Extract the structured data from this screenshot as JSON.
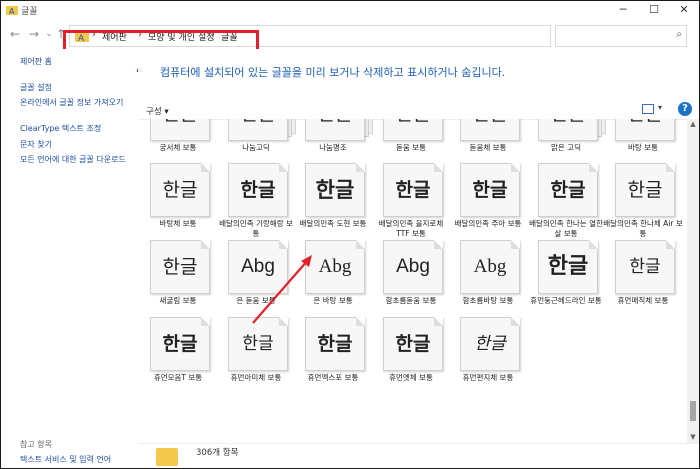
{
  "window": {
    "title": "글꼴",
    "controls": {
      "minimize": "─",
      "maximize": "☐",
      "close": "✕"
    }
  },
  "nav": {
    "back": "←",
    "forward": "→",
    "recent": "⌄",
    "up": "↑",
    "breadcrumbs": [
      "제어판",
      "모양 및 개인 설정",
      "글꼴"
    ],
    "separator": "›",
    "refresh": "↻",
    "search_placeholder": ""
  },
  "sidebar": {
    "links": [
      "제어판 홈",
      "글꼴 설정",
      "온라인에서 글꼴 정보 가져오기",
      "ClearType 텍스트 조정",
      "문자 찾기",
      "모든 언어에 대한 글꼴 다운로드"
    ],
    "see_also_label": "참고 항목",
    "see_also_links": [
      "텍스트 서비스 및 입력 언어"
    ]
  },
  "main": {
    "hint": "컴퓨터에 설치되어 있는 글꼴을 미리 보거나 삭제하고 표시하거나 숨깁니다.",
    "organize": "구성 ▾",
    "help": "?",
    "status": "306개 항목"
  },
  "fonts": [
    {
      "name": "궁서체 보통",
      "sample": "한글",
      "family": false
    },
    {
      "name": "나눔고딕",
      "sample": "한글",
      "family": true
    },
    {
      "name": "나눔명조",
      "sample": "한글",
      "family": true
    },
    {
      "name": "돋움 보통",
      "sample": "한글",
      "family": false
    },
    {
      "name": "돋움체 보통",
      "sample": "한글",
      "family": false
    },
    {
      "name": "맑은 고딕",
      "sample": "한글",
      "family": true
    },
    {
      "name": "바탕 보통",
      "sample": "한글",
      "family": false
    },
    {
      "name": "바탕체 보통",
      "sample": "한글",
      "family": false
    },
    {
      "name": "배달의민족 기랑해랑 보통",
      "sample": "한글",
      "family": false
    },
    {
      "name": "배달의민족 도현 보통",
      "sample": "한글",
      "family": false
    },
    {
      "name": "배달의민족 을지로체 TTF 보통",
      "sample": "한글",
      "family": false
    },
    {
      "name": "배달의민족 주아 보통",
      "sample": "한글",
      "family": false
    },
    {
      "name": "배달의민족 한나는 열한살 보통",
      "sample": "한글",
      "family": false
    },
    {
      "name": "배달의민족 한나체 Air 보통",
      "sample": "한글",
      "family": false
    },
    {
      "name": "새굴림 보통",
      "sample": "한글",
      "family": false
    },
    {
      "name": "은 돋움 보통",
      "sample": "Abg",
      "family": false
    },
    {
      "name": "은 바탕 보통",
      "sample": "Abg",
      "family": false
    },
    {
      "name": "함초롬돋움 보통",
      "sample": "Abg",
      "family": false
    },
    {
      "name": "함초롬바탕 보통",
      "sample": "Abg",
      "family": false
    },
    {
      "name": "휴먼둥근헤드라인 보통",
      "sample": "한글",
      "family": false
    },
    {
      "name": "휴먼매직체 보통",
      "sample": "한글",
      "family": false
    },
    {
      "name": "휴먼모음T 보통",
      "sample": "한글",
      "family": false
    },
    {
      "name": "휴먼아미체 보통",
      "sample": "한글",
      "family": false
    },
    {
      "name": "휴먼엑스포 보통",
      "sample": "한글",
      "family": false
    },
    {
      "name": "휴먼옛체 보통",
      "sample": "한글",
      "family": false
    },
    {
      "name": "휴먼편지체 보통",
      "sample": "한글",
      "family": false
    }
  ],
  "colors": {
    "annotation": "#e0202a",
    "link": "#1c4ea3",
    "hint": "#1c5fb5",
    "help": "#1a73c9"
  }
}
